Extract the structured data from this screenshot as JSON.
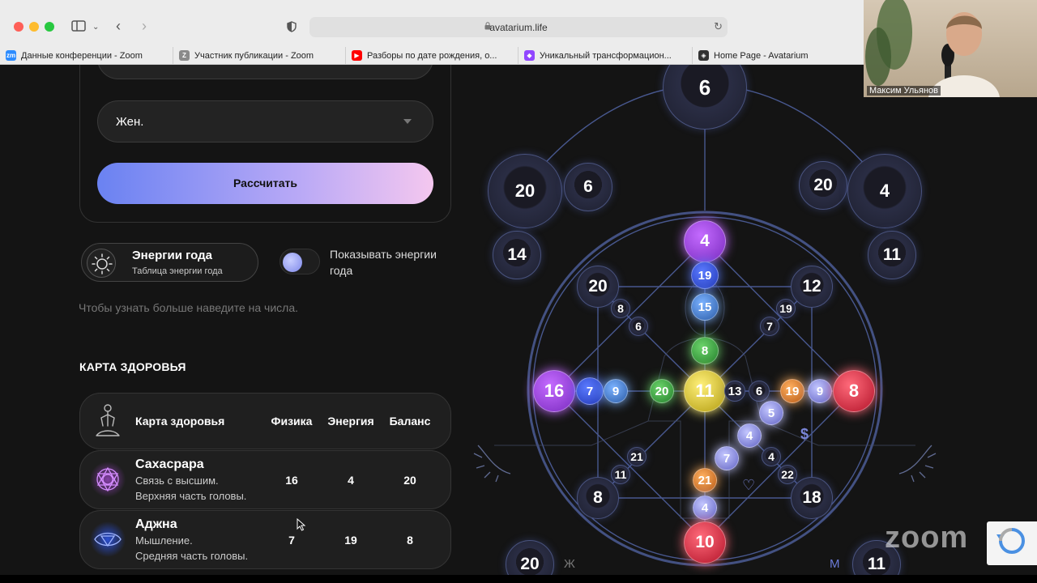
{
  "browser": {
    "url": "avatarium.life",
    "tabs": [
      {
        "label": "Данные конференции - Zoom",
        "favicon": "zoom-icon",
        "color": "#2d8cff",
        "glyph": "zm"
      },
      {
        "label": "Участник публикации - Zoom",
        "favicon": "zoom-z-icon",
        "color": "#8a8a8a",
        "glyph": "Z"
      },
      {
        "label": "Разборы по дате рождения, о...",
        "favicon": "youtube-icon",
        "color": "#ff0000",
        "glyph": "▶"
      },
      {
        "label": "Уникальный трансформацион...",
        "favicon": "twitch-icon",
        "color": "#9146ff",
        "glyph": "◆"
      },
      {
        "label": "Home Page - Avatarium",
        "favicon": "avatarium-icon",
        "color": "#333333",
        "glyph": "◈"
      }
    ]
  },
  "form": {
    "gender_value": "Жен.",
    "calculate_label": "Рассчитать"
  },
  "energy": {
    "title": "Энергии года",
    "subtitle": "Таблица энергии года",
    "toggle_label": "Показывать энергии года",
    "toggle_on": false
  },
  "hint": "Чтобы узнать больше наведите на числа.",
  "health": {
    "heading": "КАРТА ЗДОРОВЬЯ",
    "columns": {
      "name": "Карта здоровья",
      "physics": "Физика",
      "energy": "Энергия",
      "balance": "Баланс"
    },
    "rows": [
      {
        "name": "Сахасрара",
        "desc1": "Связь с высшим.",
        "desc2": "Верхняя часть головы.",
        "physics": "16",
        "energy": "4",
        "balance": "20",
        "color": "#b04ce0"
      },
      {
        "name": "Аджна",
        "desc1": "Мышление.",
        "desc2": "Средняя часть головы.",
        "physics": "7",
        "energy": "19",
        "balance": "8",
        "color": "#3a64ff"
      }
    ]
  },
  "diagram": {
    "labels": {
      "female": "Ж",
      "male": "М",
      "dollar": "$",
      "heart": "♡"
    },
    "nodes": [
      {
        "v": "6",
        "kind": "dark"
      },
      {
        "v": "20",
        "kind": "dark"
      },
      {
        "v": "6",
        "kind": "dark"
      },
      {
        "v": "20",
        "kind": "dark"
      },
      {
        "v": "4",
        "kind": "dark"
      },
      {
        "v": "14",
        "kind": "dark"
      },
      {
        "v": "11",
        "kind": "dark"
      },
      {
        "v": "4",
        "kind": "purple"
      },
      {
        "v": "19",
        "kind": "blue"
      },
      {
        "v": "15",
        "kind": "lightblue"
      },
      {
        "v": "8",
        "kind": "green"
      },
      {
        "v": "20",
        "kind": "dark"
      },
      {
        "v": "8",
        "kind": "dark"
      },
      {
        "v": "6",
        "kind": "dark"
      },
      {
        "v": "12",
        "kind": "dark"
      },
      {
        "v": "19",
        "kind": "dark"
      },
      {
        "v": "7",
        "kind": "dark"
      },
      {
        "v": "16",
        "kind": "purple"
      },
      {
        "v": "7",
        "kind": "blue"
      },
      {
        "v": "9",
        "kind": "lightblue"
      },
      {
        "v": "20",
        "kind": "green"
      },
      {
        "v": "11",
        "kind": "yellow"
      },
      {
        "v": "13",
        "kind": "dark"
      },
      {
        "v": "6",
        "kind": "dark"
      },
      {
        "v": "19",
        "kind": "orange"
      },
      {
        "v": "9",
        "kind": "lavender"
      },
      {
        "v": "8",
        "kind": "red"
      },
      {
        "v": "5",
        "kind": "lavender"
      },
      {
        "v": "4",
        "kind": "lavender"
      },
      {
        "v": "7",
        "kind": "lavender"
      },
      {
        "v": "4",
        "kind": "dark"
      },
      {
        "v": "22",
        "kind": "dark"
      },
      {
        "v": "21",
        "kind": "dark"
      },
      {
        "v": "11",
        "kind": "dark"
      },
      {
        "v": "8",
        "kind": "dark"
      },
      {
        "v": "18",
        "kind": "dark"
      },
      {
        "v": "21",
        "kind": "orange"
      },
      {
        "v": "4",
        "kind": "lavender"
      },
      {
        "v": "10",
        "kind": "red"
      },
      {
        "v": "20",
        "kind": "dark"
      },
      {
        "v": "11",
        "kind": "dark"
      }
    ]
  },
  "webcam": {
    "name": "Максим Ульянов"
  },
  "zoom_watermark": "zoom",
  "colors": {
    "purple": "#9b3fd6",
    "blue": "#2f4fd8",
    "lightblue": "#4b86d6",
    "green": "#3aa845",
    "yellow": "#d9c21c",
    "orange": "#d9822b",
    "lavender": "#8c8fe0",
    "red": "#d7263d",
    "dark": "#1e1e2c"
  }
}
